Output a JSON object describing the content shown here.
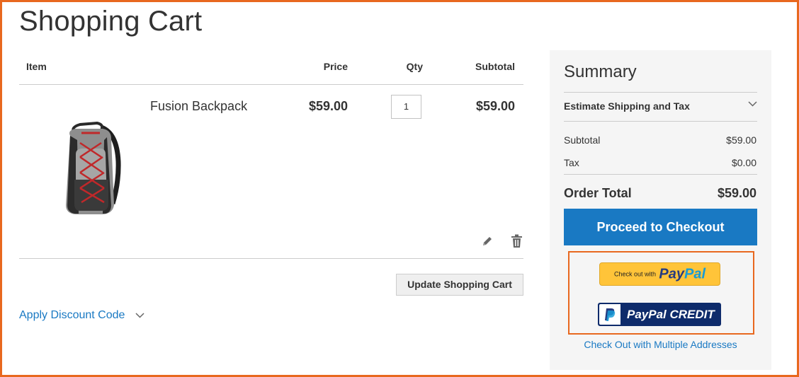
{
  "page": {
    "title": "Shopping Cart"
  },
  "cart": {
    "headers": {
      "item": "Item",
      "price": "Price",
      "qty": "Qty",
      "subtotal": "Subtotal"
    },
    "items": [
      {
        "name": "Fusion Backpack",
        "price": "$59.00",
        "qty": "1",
        "subtotal": "$59.00"
      }
    ],
    "update_label": "Update Shopping Cart",
    "discount_label": "Apply Discount Code"
  },
  "summary": {
    "title": "Summary",
    "estimate_label": "Estimate Shipping and Tax",
    "subtotal_label": "Subtotal",
    "subtotal_value": "$59.00",
    "tax_label": "Tax",
    "tax_value": "$0.00",
    "order_total_label": "Order Total",
    "order_total_value": "$59.00",
    "checkout_label": "Proceed to Checkout",
    "paypal_checkout": {
      "prefix": "Check out with",
      "logo_pay": "Pay",
      "logo_pal": "Pal"
    },
    "paypal_credit_label": "PayPal CREDIT",
    "multi_address_label": "Check Out with Multiple Addresses"
  },
  "colors": {
    "accent": "#1979c3",
    "highlight_border": "#e8681f",
    "paypal_gold": "#ffc439",
    "paypal_navy": "#0e2b6b"
  },
  "icons": [
    "edit-icon",
    "trash-icon",
    "chevron-down-icon",
    "paypal-p-icon"
  ]
}
